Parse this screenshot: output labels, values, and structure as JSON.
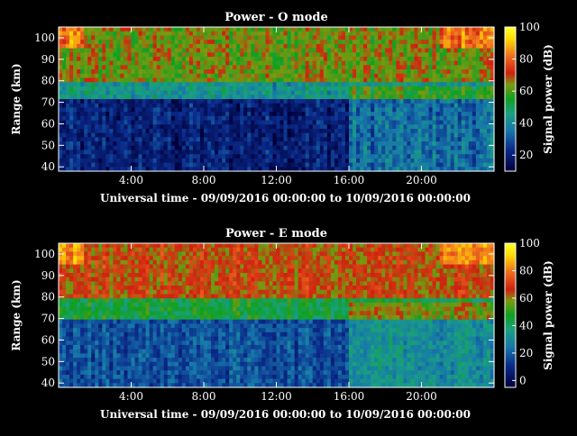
{
  "chart_data": [
    {
      "type": "heatmap",
      "title": "Power - O mode",
      "xlabel": "Universal time - 09/09/2016 00:00:00 to 10/09/2016 00:00:00",
      "ylabel": "Range (km)",
      "xlim": [
        0,
        24
      ],
      "ylim": [
        38,
        105
      ],
      "x_ticks": [
        "4:00",
        "8:00",
        "12:00",
        "16:00",
        "20:00"
      ],
      "y_ticks": [
        "40",
        "50",
        "60",
        "70",
        "80",
        "90",
        "100"
      ],
      "colorbar": {
        "label": "Signal power (dB)",
        "ticks": [
          "20",
          "40",
          "60",
          "80",
          "100"
        ],
        "range": [
          10,
          100
        ]
      },
      "layers": [
        {
          "range_km": [
            80,
            105
          ],
          "power_db": 63
        },
        {
          "range_km": [
            72,
            80
          ],
          "power_db": 43
        },
        {
          "range_km": [
            38,
            72
          ],
          "power_db": 20
        }
      ]
    },
    {
      "type": "heatmap",
      "title": "Power - E mode",
      "xlabel": "Universal time - 09/09/2016 00:00:00 to 10/09/2016 00:00:00",
      "ylabel": "Range (km)",
      "xlim": [
        0,
        24
      ],
      "ylim": [
        38,
        105
      ],
      "x_ticks": [
        "4:00",
        "8:00",
        "12:00",
        "16:00",
        "20:00"
      ],
      "y_ticks": [
        "40",
        "50",
        "60",
        "70",
        "80",
        "90",
        "100"
      ],
      "colorbar": {
        "label": "Signal power (dB)",
        "ticks": [
          "0",
          "20",
          "40",
          "60",
          "80",
          "100"
        ],
        "range": [
          -5,
          100
        ]
      },
      "layers": [
        {
          "range_km": [
            80,
            105
          ],
          "power_db": 65
        },
        {
          "range_km": [
            70,
            80
          ],
          "power_db": 45
        },
        {
          "range_km": [
            38,
            70
          ],
          "power_db": 18
        }
      ]
    }
  ]
}
